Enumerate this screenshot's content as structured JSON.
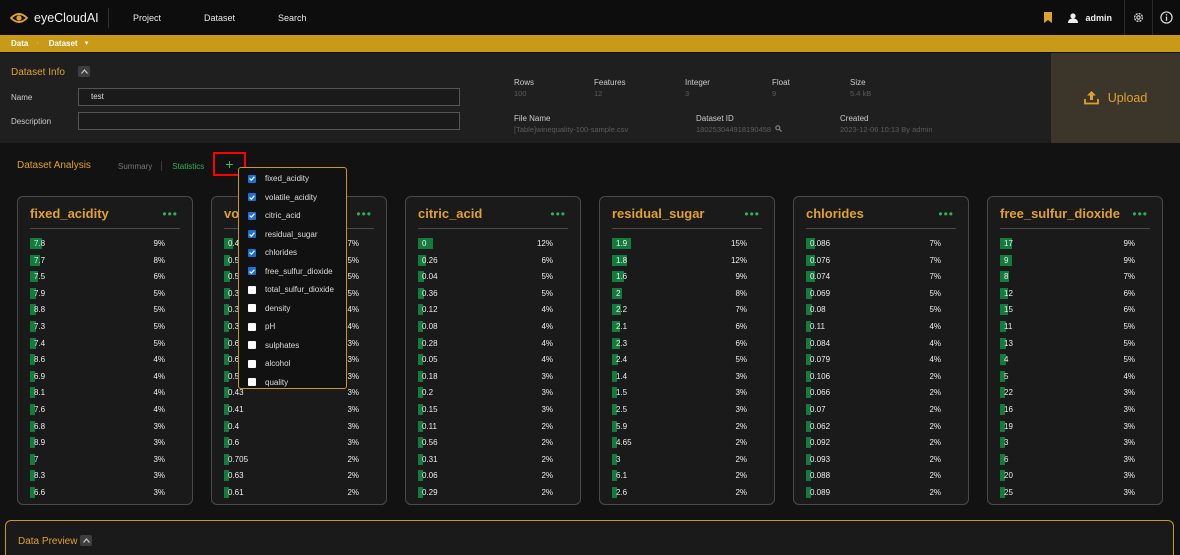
{
  "app": {
    "name": "eyeCloudAI"
  },
  "nav": {
    "project": "Project",
    "dataset": "Dataset",
    "search": "Search"
  },
  "user": {
    "name": "admin"
  },
  "breadcrumb": {
    "level1": "Data",
    "level2": "Dataset"
  },
  "dataset_info": {
    "title": "Dataset Info",
    "name_label": "Name",
    "name_value": "test",
    "description_label": "Description",
    "description_value": "",
    "rows_label": "Rows",
    "rows_value": "100",
    "features_label": "Features",
    "features_value": "12",
    "integer_label": "Integer",
    "integer_value": "3",
    "float_label": "Float",
    "float_value": "9",
    "size_label": "Size",
    "size_value": "5.4 kB",
    "filename_label": "File Name",
    "filename_value": "[Table]winequality-100-sample.csv",
    "datasetid_label": "Dataset ID",
    "datasetid_value": "180253044918190458",
    "created_label": "Created",
    "created_value": "2023-12-06 10:13 By admin",
    "upload_label": "Upload"
  },
  "analysis": {
    "title": "Dataset Analysis",
    "tab_summary": "Summary",
    "tab_statistics": "Statistics",
    "add_label": "+"
  },
  "colors": {
    "accent": "#e0a22a",
    "bar": "#127c3c",
    "tab_active": "#2db05e",
    "header_bar": "#c99a18"
  },
  "column_menu": [
    {
      "label": "fixed_acidity",
      "checked": true
    },
    {
      "label": "volatile_acidity",
      "checked": true
    },
    {
      "label": "citric_acid",
      "checked": true
    },
    {
      "label": "residual_sugar",
      "checked": true
    },
    {
      "label": "chlorides",
      "checked": true
    },
    {
      "label": "free_sulfur_dioxide",
      "checked": true
    },
    {
      "label": "total_sulfur_dioxide",
      "checked": false
    },
    {
      "label": "density",
      "checked": false
    },
    {
      "label": "pH",
      "checked": false
    },
    {
      "label": "sulphates",
      "checked": false
    },
    {
      "label": "alcohol",
      "checked": false
    },
    {
      "label": "quality",
      "checked": false
    }
  ],
  "cards": [
    {
      "title": "fixed_acidity",
      "rows": [
        {
          "v": "7.8",
          "p": "9%"
        },
        {
          "v": "7.7",
          "p": "8%"
        },
        {
          "v": "7.5",
          "p": "6%"
        },
        {
          "v": "7.9",
          "p": "5%"
        },
        {
          "v": "8.8",
          "p": "5%"
        },
        {
          "v": "7.3",
          "p": "5%"
        },
        {
          "v": "7.4",
          "p": "5%"
        },
        {
          "v": "8.6",
          "p": "4%"
        },
        {
          "v": "6.9",
          "p": "4%"
        },
        {
          "v": "8.1",
          "p": "4%"
        },
        {
          "v": "7.6",
          "p": "4%"
        },
        {
          "v": "6.8",
          "p": "3%"
        },
        {
          "v": "8.9",
          "p": "3%"
        },
        {
          "v": "7",
          "p": "3%"
        },
        {
          "v": "8.3",
          "p": "3%"
        },
        {
          "v": "6.6",
          "p": "3%"
        }
      ]
    },
    {
      "title": "volatile_acidity",
      "rows": [
        {
          "v": "0.4",
          "p": "7%"
        },
        {
          "v": "0.5",
          "p": "5%"
        },
        {
          "v": "0.5",
          "p": "5%"
        },
        {
          "v": "0.3",
          "p": "5%"
        },
        {
          "v": "0.3",
          "p": "4%"
        },
        {
          "v": "0.3",
          "p": "4%"
        },
        {
          "v": "0.6",
          "p": "3%"
        },
        {
          "v": "0.6",
          "p": "3%"
        },
        {
          "v": "0.5",
          "p": "3%"
        },
        {
          "v": "0.43",
          "p": "3%"
        },
        {
          "v": "0.41",
          "p": "3%"
        },
        {
          "v": "0.4",
          "p": "3%"
        },
        {
          "v": "0.6",
          "p": "3%"
        },
        {
          "v": "0.705",
          "p": "2%"
        },
        {
          "v": "0.63",
          "p": "2%"
        },
        {
          "v": "0.61",
          "p": "2%"
        }
      ]
    },
    {
      "title": "citric_acid",
      "rows": [
        {
          "v": "0",
          "p": "12%"
        },
        {
          "v": "0.26",
          "p": "6%"
        },
        {
          "v": "0.04",
          "p": "5%"
        },
        {
          "v": "0.36",
          "p": "5%"
        },
        {
          "v": "0.12",
          "p": "4%"
        },
        {
          "v": "0.08",
          "p": "4%"
        },
        {
          "v": "0.28",
          "p": "4%"
        },
        {
          "v": "0.05",
          "p": "4%"
        },
        {
          "v": "0.18",
          "p": "3%"
        },
        {
          "v": "0.2",
          "p": "3%"
        },
        {
          "v": "0.15",
          "p": "3%"
        },
        {
          "v": "0.11",
          "p": "2%"
        },
        {
          "v": "0.56",
          "p": "2%"
        },
        {
          "v": "0.31",
          "p": "2%"
        },
        {
          "v": "0.06",
          "p": "2%"
        },
        {
          "v": "0.29",
          "p": "2%"
        }
      ]
    },
    {
      "title": "residual_sugar",
      "rows": [
        {
          "v": "1.9",
          "p": "15%"
        },
        {
          "v": "1.8",
          "p": "12%"
        },
        {
          "v": "1.6",
          "p": "9%"
        },
        {
          "v": "2",
          "p": "8%"
        },
        {
          "v": "2.2",
          "p": "7%"
        },
        {
          "v": "2.1",
          "p": "6%"
        },
        {
          "v": "2.3",
          "p": "6%"
        },
        {
          "v": "2.4",
          "p": "5%"
        },
        {
          "v": "1.4",
          "p": "3%"
        },
        {
          "v": "1.5",
          "p": "3%"
        },
        {
          "v": "2.5",
          "p": "3%"
        },
        {
          "v": "5.9",
          "p": "2%"
        },
        {
          "v": "4.65",
          "p": "2%"
        },
        {
          "v": "3",
          "p": "2%"
        },
        {
          "v": "6.1",
          "p": "2%"
        },
        {
          "v": "2.6",
          "p": "2%"
        }
      ]
    },
    {
      "title": "chlorides",
      "rows": [
        {
          "v": "0.086",
          "p": "7%"
        },
        {
          "v": "0.076",
          "p": "7%"
        },
        {
          "v": "0.074",
          "p": "7%"
        },
        {
          "v": "0.069",
          "p": "5%"
        },
        {
          "v": "0.08",
          "p": "5%"
        },
        {
          "v": "0.11",
          "p": "4%"
        },
        {
          "v": "0.084",
          "p": "4%"
        },
        {
          "v": "0.079",
          "p": "4%"
        },
        {
          "v": "0.106",
          "p": "2%"
        },
        {
          "v": "0.066",
          "p": "2%"
        },
        {
          "v": "0.07",
          "p": "2%"
        },
        {
          "v": "0.062",
          "p": "2%"
        },
        {
          "v": "0.092",
          "p": "2%"
        },
        {
          "v": "0.093",
          "p": "2%"
        },
        {
          "v": "0.088",
          "p": "2%"
        },
        {
          "v": "0.089",
          "p": "2%"
        }
      ]
    },
    {
      "title": "free_sulfur_dioxide",
      "rows": [
        {
          "v": "17",
          "p": "9%"
        },
        {
          "v": "9",
          "p": "9%"
        },
        {
          "v": "8",
          "p": "7%"
        },
        {
          "v": "12",
          "p": "6%"
        },
        {
          "v": "15",
          "p": "6%"
        },
        {
          "v": "11",
          "p": "5%"
        },
        {
          "v": "13",
          "p": "5%"
        },
        {
          "v": "4",
          "p": "5%"
        },
        {
          "v": "5",
          "p": "4%"
        },
        {
          "v": "22",
          "p": "3%"
        },
        {
          "v": "16",
          "p": "3%"
        },
        {
          "v": "19",
          "p": "3%"
        },
        {
          "v": "3",
          "p": "3%"
        },
        {
          "v": "6",
          "p": "3%"
        },
        {
          "v": "20",
          "p": "3%"
        },
        {
          "v": "25",
          "p": "3%"
        }
      ]
    }
  ],
  "data_preview": {
    "title": "Data Preview"
  }
}
